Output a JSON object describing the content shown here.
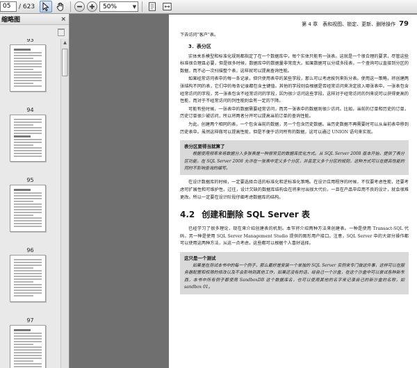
{
  "toolbar": {
    "page_current": "05",
    "page_total": "/ 623",
    "zoom": "50%"
  },
  "sidebar": {
    "title": "缩略图",
    "close_glyph": "×",
    "thumbnails": [
      {
        "page": "93"
      },
      {
        "page": "94"
      },
      {
        "page": "95"
      },
      {
        "page": "96"
      },
      {
        "page": "97"
      }
    ]
  },
  "document": {
    "running_head": "第 4 章　表和视图、锁定、更新、删除操作",
    "page_number": "79",
    "p0": "下去访问\"客户\"表。",
    "subhead": "3．表分区",
    "p1": "实体关系模型和标准化规则都指定了在一个数据库中，每个实体只能有一张表。这就是一个很合理的要求，尽管这些标准很合理且必要，但是很多时候，数据库中的数据量非常庞大。如果数据可以分成多段表，一个查询可以直接到分区的数据，而不必一次扫描整个表，这样就可以提高查询性能。",
    "p2": "如果经常访问表中的每一条记录，但只使用表中的某些字段，那么可以考虑按列来拆分表。使用这一策略，将创建两张结构不同的表，它们中的每条记录都包含主键值。其他的字段则会根据是否经常访问来决定放入哪张表中。一张表包含经常访问的字段，另一张表包含不经常访问的字段，因为很少访问这些字段。这样对于经常访问的列来说可以获得更高的性能，而对于不经常访问的列性能则会有一定的下降。",
    "p3": "可能有些时候，一张表中的数据需要经常访问，而另一张表中的数据则很少访问。比如，当前的订单和历史的订单，历史订单很少被访问，所以将两者分开可以提高当前订单的查询性能。",
    "p4": "为此，创建两个相同的表，一个包含当前的数据，另一个包含历史数据。当历史数据不再需要时可以从当前表中移到历史表中。虽然这样做可以提高性能，但是不便于访问所有的数据，这可以通过 UNION 语句来实现。",
    "note_title": "表分区要得当就算了",
    "note_text": "根据使用频率来将数据分入多张表是一种很常见的数据库优化方式。从 SQL Server 2008 版本开始，提供了表分区功能，在 SQL Server 2008 允许在一张表中定义多个分区，并且定义多个分区的规则，这种方式可以在提高性能的同时不影响查询的编写。",
    "p5": "在设计数据库的时候，一定要选择合适的标准化和逆标准化策略。在设计应用程序的时候，不仅要考虑性能，还要考虑可扩展性和可维护性。过往，设计欠缺的数据库结构会在将来付出很大代价。一旦在产品中应用不良的设计，就会很难更改。所以一定要在设计阶段仔细考虑数据库的结构。",
    "section_number": "4.2",
    "section_title": "创建和删除 SQL Server 表",
    "p6": "已经学习了很多理论，现在来介绍创建表的机制。本节将介绍两种方法来创建表。一种是使用 Transact-SQL 代码，另一种是使用 SQL Server Management Studio 提供的图形用户接口。注意，SQL Server 中的大部分操作都可以使用这两种方法，从这一点考虑，这些都可以根据个人喜好选择。",
    "note2_title": "这只是一个测试",
    "note2_text": "如果是在测试本书中的每一个例子，那么最好是安装一个单独的 SQL Server 实例来专门做这件事，这样可以在服务器配置和权限的修改以及不会影响到其他工作，如果还没有的话，给自己一个沙盒，在这个沙盒中可以尝试各种新东西，本书中所有例子都使用 SandboxDB 这个数据库名，也可以使用其他的名字来记录自己的新沙盒的名称，如 sandbox 01。"
  }
}
